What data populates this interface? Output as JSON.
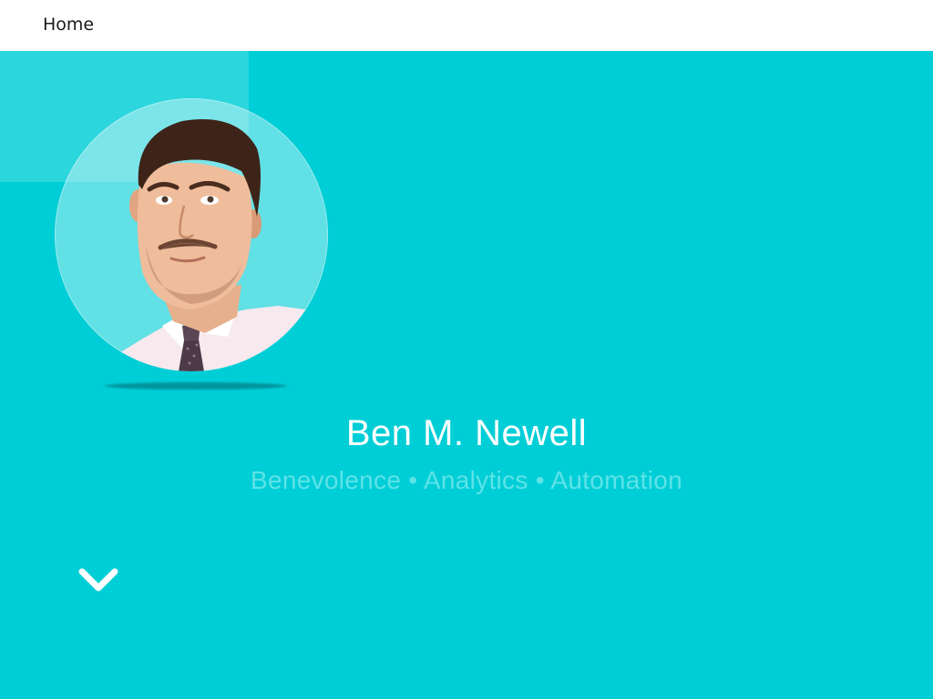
{
  "nav": {
    "home_label": "Home"
  },
  "hero": {
    "name": "Ben M. Newell",
    "tagline": "Benevolence • Analytics • Automation",
    "scroll_icon": "chevron-down-icon"
  },
  "colors": {
    "hero_bg": "#00ced6",
    "topbar_bg": "#ffffff",
    "name_text": "#ffffff",
    "tagline_text": "#5ee3e8"
  }
}
